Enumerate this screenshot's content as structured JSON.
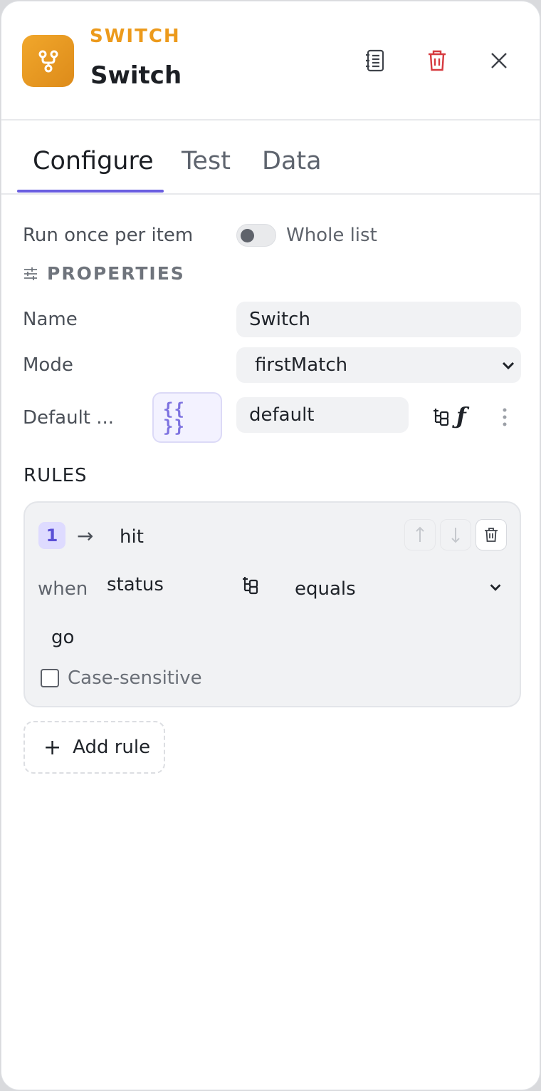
{
  "header": {
    "kind": "SWITCH",
    "title": "Switch",
    "icon": "branch-icon",
    "accent": "#ec9a1c"
  },
  "tabs": [
    {
      "label": "Configure",
      "active": true
    },
    {
      "label": "Test",
      "active": false
    },
    {
      "label": "Data",
      "active": false
    }
  ],
  "run_mode": {
    "label": "Run once per item",
    "toggle_label": "Whole list",
    "toggle_on": false
  },
  "properties": {
    "title": "PROPERTIES",
    "name_label": "Name",
    "name_value": "Switch",
    "mode_label": "Mode",
    "mode_value": "firstMatch",
    "default_label": "Default ...",
    "template_glyph": "{{\n}}",
    "default_value": "default",
    "fx_glyph": "ƒ"
  },
  "rules": {
    "title": "RULES",
    "items": [
      {
        "number": "1",
        "arrow": "→",
        "output": "hit",
        "when_label": "when",
        "field": "status",
        "operator": "equals",
        "value": "go",
        "case_sensitive_label": "Case-sensitive",
        "case_sensitive": false
      }
    ],
    "add_label": "Add rule",
    "add_glyph": "+"
  }
}
